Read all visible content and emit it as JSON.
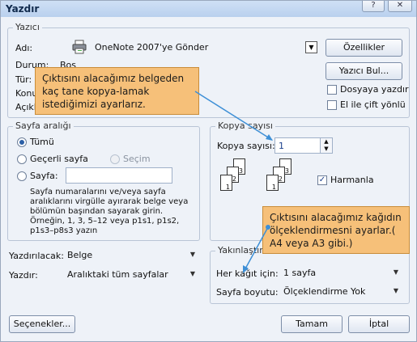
{
  "window": {
    "title": "Yazdır",
    "help_glyph": "?",
    "close_glyph": "✕"
  },
  "printer": {
    "group_label": "Yazıcı",
    "name_label": "Adı:",
    "name_value": "OneNote 2007'ye Gönder",
    "status_label": "Durum:",
    "status_value": "Boş",
    "type_label": "Tür:",
    "location_label": "Konum:",
    "comment_label": "Açıklama:",
    "properties_button": "Özellikler",
    "find_printer_button": "Yazıcı Bul...",
    "print_to_file_label": "Dosyaya yazdır",
    "manual_duplex_label": "El ile çift yönlü",
    "icon": "printer-icon"
  },
  "page_range": {
    "group_label": "Sayfa aralığı",
    "all_label": "Tümü",
    "current_label": "Geçerli sayfa",
    "selection_label": "Seçim",
    "pages_label": "Sayfa:",
    "pages_value": "",
    "help_text": "Sayfa numaralarını ve/veya sayfa aralıklarını virgülle ayırarak belge veya bölümün başından sayarak girin. Örneğin, 1, 3, 5–12 veya p1s1, p1s2, p1s3–p8s3 yazın"
  },
  "copies": {
    "group_label": "Kopya sayısı",
    "count_label": "Kopya sayısı:",
    "count_value": "1",
    "collate_label": "Harmanla",
    "collate_checked": true,
    "page_numbers": [
      "1",
      "2",
      "3"
    ]
  },
  "print_what": {
    "label": "Yazdırılacak:",
    "value": "Belge"
  },
  "print": {
    "label": "Yazdır:",
    "value": "Aralıktaki tüm sayfalar"
  },
  "zoom": {
    "group_label": "Yakınlaştır",
    "pages_per_sheet_label": "Her kağıt için:",
    "pages_per_sheet_value": "1 sayfa",
    "scale_label": "Sayfa boyutu:",
    "scale_value": "Ölçeklendirme Yok"
  },
  "buttons": {
    "options": "Seçenekler...",
    "ok": "Tamam",
    "cancel": "İptal"
  },
  "callouts": {
    "copies_note": "Çıktısını alacağımız belgeden kaç tane kopya-lamak istediğimizi ayarlarız.",
    "scale_note": "Çıktısını alacağımız kağıdın ölçeklendirmesni ayarlar.( A4 veya A3 gibi.)"
  },
  "colors": {
    "callout_fill": "#f6c079",
    "arrow_color": "#3d8fd6",
    "accent": "#2b5fa6"
  }
}
